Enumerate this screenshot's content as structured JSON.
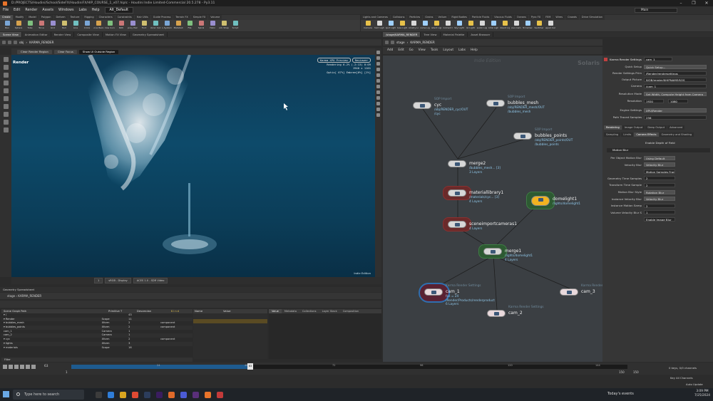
{
  "window": {
    "title": "D:/PROJECTS/Houdini/School/SideFX/HoudiniFX/HIP_COURSE_1_v07.hiplc - Houdini Indie Limited-Commercial 20.5.278 - Py3.11",
    "controls": [
      "–",
      "❐",
      "✕"
    ]
  },
  "menubar": {
    "items": [
      "File",
      "Edit",
      "Render",
      "Assets",
      "Windows",
      "Labs",
      "Help"
    ],
    "desktop": "Alt_Default",
    "main": "Main"
  },
  "shelf_tabs": [
    "Create",
    "Modify",
    "Model",
    "Polygon",
    "Deform",
    "Texture",
    "Rigging",
    "Characters",
    "Constraints",
    "Hair Utils",
    "Guide Process",
    "Terrain FX",
    "Simple FX",
    "Volume",
    "Lights and Cameras",
    "Collisions",
    "Particles",
    "Grains",
    "Vellum",
    "Rigid Bodies",
    "Particle Fluids",
    "Viscous Fluids",
    "Oceans",
    "Pyro FX",
    "FEM",
    "Wires",
    "Crowds",
    "Drive Simulation"
  ],
  "shelf_tools_left": [
    "Box",
    "Sphere",
    "Tube",
    "Torus",
    "Grid",
    "Null",
    "Line",
    "Circle",
    "Curve Bezier",
    "Draw Curve",
    "Path",
    "Spray Paint",
    "Font",
    "Platonic Solids",
    "L-System",
    "Metaball",
    "File",
    "Spiral",
    "Helix",
    "Quick Shapes",
    "Script"
  ],
  "shelf_tools_right": [
    "Camera",
    "Point Light",
    "Spot Light",
    "Area Light",
    "Geometry Light",
    "Volume Light",
    "Distant Light",
    "Environment Light",
    "Sky Light",
    "GI Light",
    "Caustic Light",
    "Portal Light",
    "Ambient Light",
    "Stereo Camera",
    "VR Camera",
    "Switcher",
    "Gamepad Camera"
  ],
  "pane_tabs_left": [
    "Scene View",
    "Animation Editor",
    "Render View",
    "Composite View",
    "Motion FX View",
    "Geometry Spreadsheet"
  ],
  "pane_tabs_right": [
    "/stage/KARMA_RENDER",
    "Tree View",
    "Material Palette",
    "Asset Browser"
  ],
  "viewport": {
    "path": [
      "obj",
      "KARMA_RENDER"
    ],
    "buttons": [
      "Clear Render Region",
      "Clear Focus",
      "Show UI Outside Region"
    ],
    "title": "Render",
    "engine": "Karma XPU Preview",
    "camera_btn": "Reviewer",
    "stats": [
      "Rendering  6.2%  (-2:13)  0:09",
      "1940 x 1101",
      "Optix[ 67%] Embree[0%]  [1%]"
    ],
    "watermark": "Indie Edition",
    "footer": [
      "sRGB - Display",
      "ACES 1.0 - SDR Video"
    ],
    "frame": "1"
  },
  "net_view": {
    "path": [
      "stage",
      "KARMA_RENDER"
    ],
    "menu": [
      "Add",
      "Edit",
      "Go",
      "View",
      "Tools",
      "Layout",
      "Labs",
      "Help"
    ],
    "context": "Solaris",
    "edition": "Indie Edition",
    "nodes": [
      {
        "id": "cyc",
        "type": "SOP Import",
        "name": "cyc",
        "info": [
          "/obj/RENDER_cyc/OUT",
          "/cyc"
        ]
      },
      {
        "id": "bubbles_mesh",
        "type": "SOP Import",
        "name": "bubbles_mesh",
        "info": [
          "/obj/RENDER_mesh/OUT",
          "/bubbles_mesh"
        ]
      },
      {
        "id": "bubbles_points",
        "type": "SOP Import",
        "name": "bubbles_points",
        "info": [
          "/obj/RENDER_points/OUT",
          "/bubbles_points"
        ]
      },
      {
        "id": "merge2",
        "type": "",
        "name": "merge2",
        "info": [
          "/bubbles_mesh... [3]",
          "3 Layers"
        ]
      },
      {
        "id": "materiallibrary1",
        "type": "",
        "name": "materiallibrary1",
        "info": [
          "/materials/cyc... [3]",
          "4 Layers"
        ]
      },
      {
        "id": "domelight1",
        "type": "",
        "name": "domelight1",
        "info": [
          "/lights/domelight1"
        ]
      },
      {
        "id": "sceneimportcameras1",
        "type": "",
        "name": "sceneimportcameras1",
        "info": [
          "4 Layers"
        ]
      },
      {
        "id": "merge1",
        "type": "",
        "name": "merge1",
        "info": [
          "/lights/domelight1",
          "4 Layers"
        ]
      },
      {
        "id": "cam_1",
        "type": "Karma Render Settings",
        "name": "cam_1",
        "info": [
          "fps = 24",
          "/Render/Products/renderproduct",
          "6 Layers"
        ]
      },
      {
        "id": "cam_2",
        "type": "Karma Render Settings",
        "name": "cam_2",
        "info": []
      },
      {
        "id": "cam_3",
        "type": "Karma Render Settings",
        "name": "cam_3",
        "info": []
      }
    ]
  },
  "props": {
    "header": "Karma Render Settings",
    "node_name": "cam_1",
    "rows": [
      {
        "label": "Quick Setup",
        "value": "Quick Setup..."
      },
      {
        "label": "Render Settings Prim",
        "value": "/Render/rendersettings"
      },
      {
        "label": "Output Picture",
        "value": "$JOB/render/$HIPNAME/$OS"
      },
      {
        "label": "Camera",
        "value": "/cam_1"
      },
      {
        "label": "Resolution Mode",
        "value": "Set Width, Compute Height from Camera"
      },
      {
        "label": "Resolution",
        "value": "1920",
        "value2": "1080"
      },
      {
        "label": "Engine Settings",
        "value": "XPU/Render"
      },
      {
        "label": "Path Traced Samples",
        "value": "256"
      }
    ],
    "tabs1": [
      "Rendering",
      "Image Output",
      "Deep Output",
      "Advanced"
    ],
    "tabs2": [
      "Sampling",
      "Limits",
      "Camera Effects",
      "Geometry and Shading"
    ],
    "dof": "Enable Depth of Field",
    "motion_blur": "Motion Blur",
    "mb_rows": [
      {
        "label": "Per Object Motion Blur",
        "value": "Using Default"
      },
      {
        "label": "Velocity Blur",
        "value": "Velocity Blur"
      },
      {
        "label": "",
        "value": "Motion Samples From Stage"
      },
      {
        "label": "Geometry Time Samples",
        "value": "2"
      },
      {
        "label": "Transform Time Sample",
        "value": "2"
      },
      {
        "label": "Motion Blur Style",
        "value": "Rotation Blur"
      },
      {
        "label": "Instance Velocity Blur",
        "value": "Velocity Blur"
      },
      {
        "label": "Instance Motion Samp",
        "value": "2"
      },
      {
        "label": "Volume Velocity Blur S",
        "value": "1"
      },
      {
        "label": "",
        "value": "Enable Image Blur"
      }
    ]
  },
  "scene_graph": {
    "label": "Geometry Spreadsheet",
    "path": [
      "stage",
      "KARMA_RENDER"
    ],
    "columns": [
      "Scene Graph Path",
      "Primitive T",
      "Descendan",
      "Kind"
    ],
    "rows": [
      {
        "path": "▾ /",
        "prim": "",
        "desc": "43",
        "kind": ""
      },
      {
        "path": "  ▾ Render",
        "prim": "Scope",
        "desc": "11",
        "kind": ""
      },
      {
        "path": "  ▾ bubbles_mesh",
        "prim": "Xform",
        "desc": "2",
        "kind": "component"
      },
      {
        "path": "  ▾ bubbles_points",
        "prim": "Xform",
        "desc": "2",
        "kind": "component"
      },
      {
        "path": "    cam_1",
        "prim": "Camera",
        "desc": "1",
        "kind": ""
      },
      {
        "path": "    cam_2",
        "prim": "Camera",
        "desc": "1",
        "kind": ""
      },
      {
        "path": "  ▾ cyc",
        "prim": "Xform",
        "desc": "2",
        "kind": "component"
      },
      {
        "path": "  ▾ lights",
        "prim": "Xform",
        "desc": "3",
        "kind": ""
      },
      {
        "path": "  ▾ materials",
        "prim": "Scope",
        "desc": "16",
        "kind": ""
      }
    ],
    "filter": "Filter",
    "nv_cols": [
      "Name",
      "Value"
    ],
    "right_tabs": [
      "Value",
      "Metadata",
      "Collections",
      "Layer Stack",
      "Composition"
    ]
  },
  "timeline": {
    "frame": "63",
    "start": "1",
    "end": "150",
    "end2": "150",
    "ticks": [
      "24",
      "48",
      "72",
      "96",
      "120",
      "144"
    ],
    "keys": "0 keys, 0/0 channels",
    "key_all": "Key All Channels",
    "auto_update": "Auto Update"
  },
  "taskbar": {
    "search": "Type here to search",
    "weather": "Today's events",
    "time": "3:09 PM",
    "date": "7/25/2024"
  }
}
